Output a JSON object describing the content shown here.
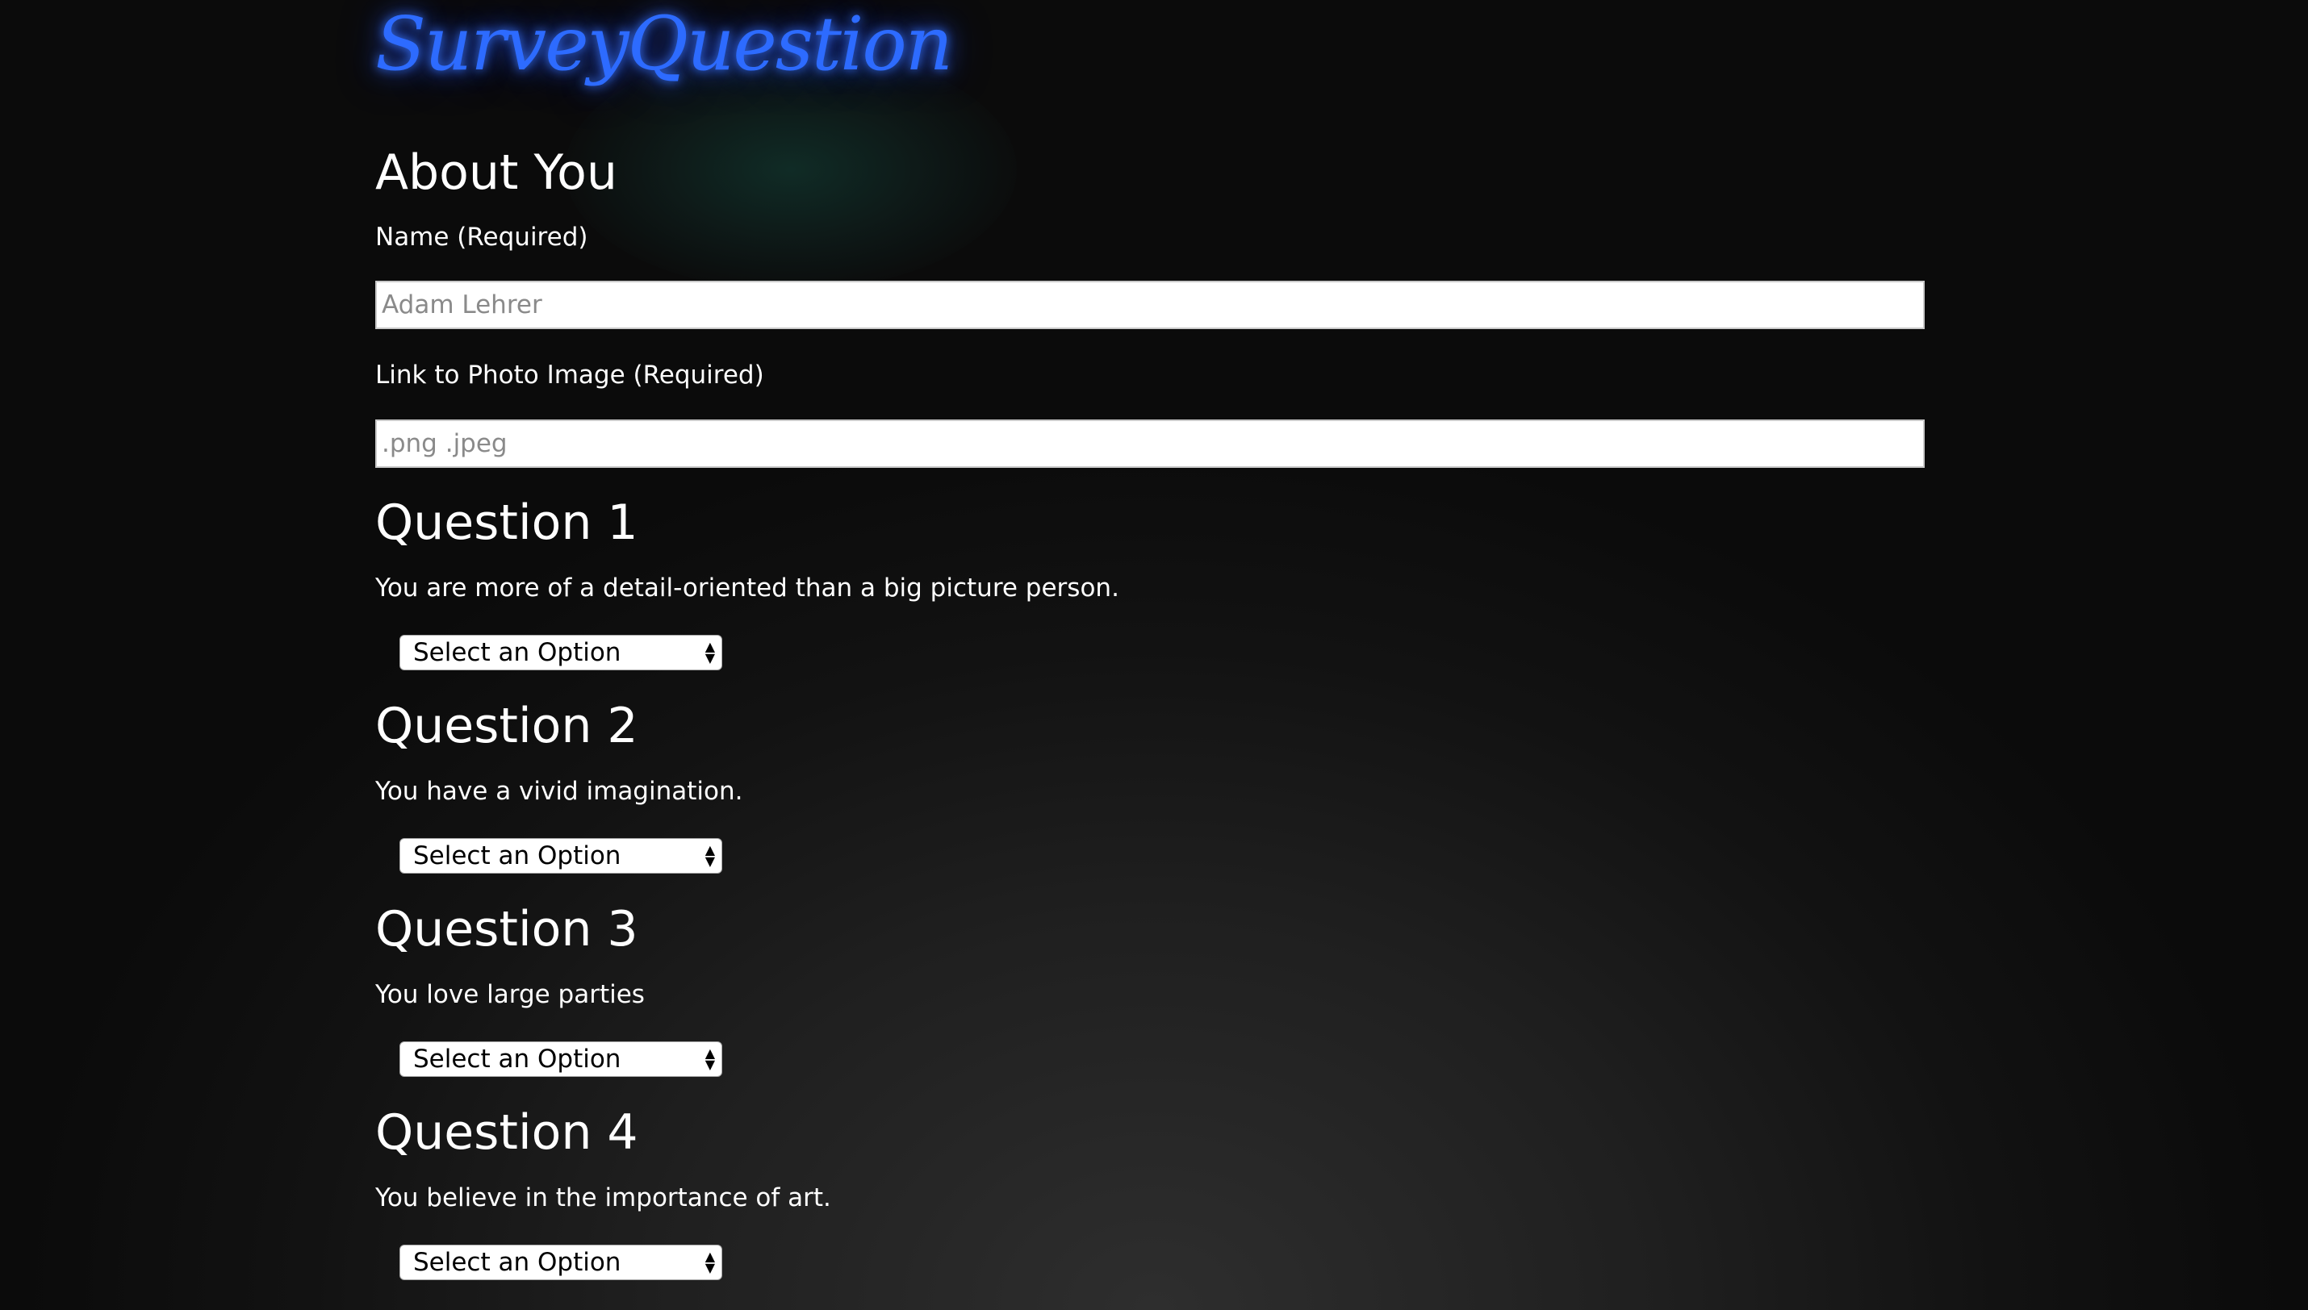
{
  "logo": {
    "text": "SurveyQuestion"
  },
  "about": {
    "title": "About You",
    "name_label": "Name (Required)",
    "name_placeholder": "Adam Lehrer",
    "photo_label": "Link to Photo Image (Required)",
    "photo_placeholder": ".png .jpeg"
  },
  "questions": [
    {
      "title": "Question 1",
      "text": "You are more of a detail-oriented than a big picture person.",
      "selected": "Select an Option"
    },
    {
      "title": "Question 2",
      "text": "You have a vivid imagination.",
      "selected": "Select an Option"
    },
    {
      "title": "Question 3",
      "text": "You love large parties",
      "selected": "Select an Option"
    },
    {
      "title": "Question 4",
      "text": "You believe in the importance of art.",
      "selected": "Select an Option"
    }
  ],
  "icons": {
    "select_arrows": "up-down-arrows-icon"
  },
  "colors": {
    "logo": "#2d6bff",
    "background": "#1f1f1f",
    "text": "#ffffff"
  }
}
